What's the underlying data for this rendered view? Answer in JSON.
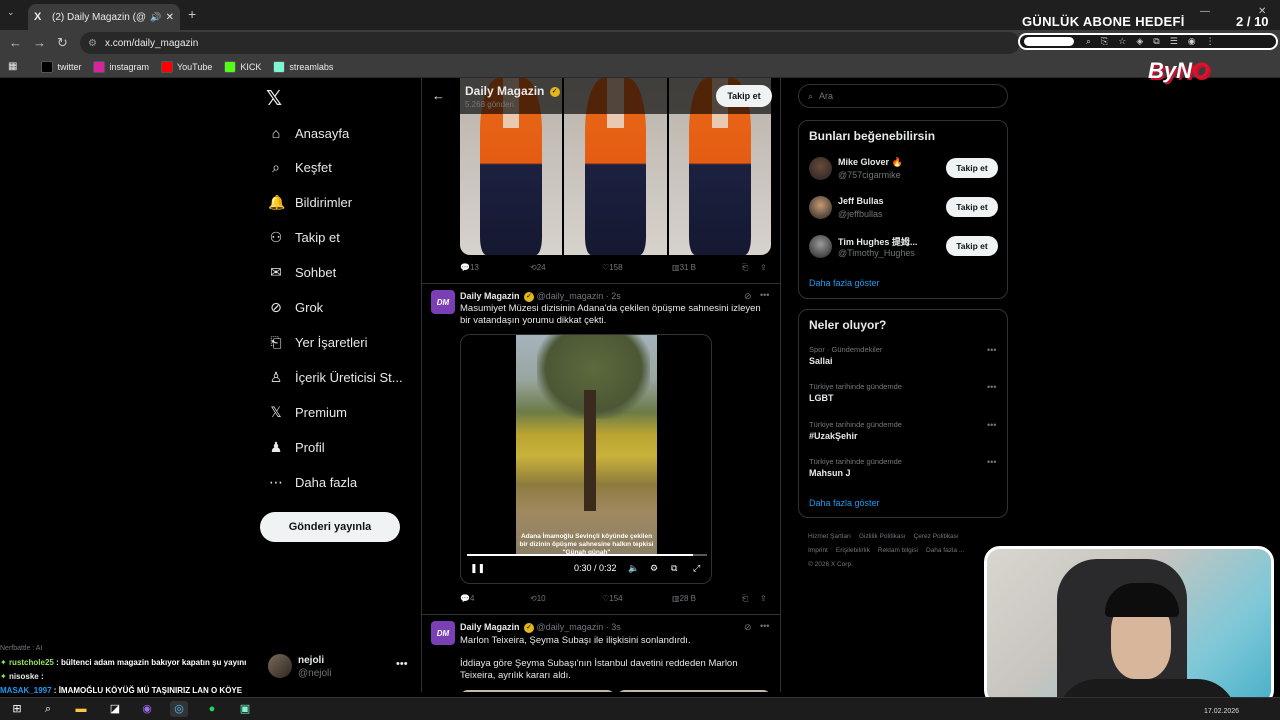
{
  "browser": {
    "tab_title": "(2) Daily Magazin (@daily_m",
    "tab_favicon": "X",
    "url": "x.com/daily_magazin",
    "bookmarks": [
      {
        "label": "twitter",
        "icon": "x-icon",
        "color": "#000000"
      },
      {
        "label": "instagram",
        "icon": "instagram-icon",
        "color": "#d6249f"
      },
      {
        "label": "YouTube",
        "icon": "youtube-icon",
        "color": "#ff0000"
      },
      {
        "label": "KICK",
        "icon": "kick-icon",
        "color": "#53fc18"
      },
      {
        "label": "streamlabs",
        "icon": "streamlabs-icon",
        "color": "#80f5d2"
      }
    ]
  },
  "overlay": {
    "goal_title": "GÜNLÜK ABONE HEDEFİ",
    "goal_count": "2 / 10",
    "goal_progress": 0.2,
    "logo": {
      "a": "ByN",
      "b": "O"
    }
  },
  "left_nav": {
    "items": [
      {
        "label": "Anasayfa",
        "icon": "home-icon"
      },
      {
        "label": "Keşfet",
        "icon": "search-icon"
      },
      {
        "label": "Bildirimler",
        "icon": "bell-icon"
      },
      {
        "label": "Takip et",
        "icon": "add-user-icon"
      },
      {
        "label": "Sohbet",
        "icon": "mail-icon"
      },
      {
        "label": "Grok",
        "icon": "grok-icon"
      },
      {
        "label": "Yer İşaretleri",
        "icon": "bookmark-icon"
      },
      {
        "label": "İçerik Üreticisi St...",
        "icon": "creator-icon"
      },
      {
        "label": "Premium",
        "icon": "x-icon"
      },
      {
        "label": "Profil",
        "icon": "profile-icon"
      },
      {
        "label": "Daha fazla",
        "icon": "more-icon"
      }
    ],
    "post_button": "Gönderi yayınla",
    "account": {
      "name": "nejoli",
      "handle": "@nejoli"
    }
  },
  "chat": {
    "header": "Nerfbattle : AI",
    "messages": [
      {
        "user": "rustchole25",
        "text": " : bültenci adam magazin bakıyor kapatın şu yayını",
        "color": "#9ce65c"
      },
      {
        "user": "nisoske",
        "text": " : ",
        "color": "#e7e9ea"
      },
      {
        "user": "MASAK_1997",
        "text": " : İMAMOĞLU KÖYÜĞ MÜ TAŞINIRIZ LAN O KÖYE",
        "color": "#1d9bf0"
      }
    ]
  },
  "profile_header": {
    "name": "Daily Magazin",
    "post_count": "5.268 gönderi",
    "follow_label": "Takip et"
  },
  "tweets": [
    {
      "stats": {
        "replies": "13",
        "retweets": "24",
        "likes": "158",
        "views": "31 B"
      }
    },
    {
      "name": "Daily Magazin",
      "handle": "@daily_magazin",
      "time": "2s",
      "text": "Masumiyet Müzesi dizisinin Adana'da çekilen öpüşme sahnesini izleyen bir vatandaşın yorumu dikkat çekti.",
      "video": {
        "caption": "Adana İmamoğlu Sevinçli köyünde çekilen bir dizinin öpüşme sahnesine halkın tepkisi \"Günah günah\"",
        "time": "0:30 / 0:32",
        "progress": 0.94
      },
      "stats": {
        "replies": "4",
        "retweets": "10",
        "likes": "154",
        "views": "28 B"
      }
    },
    {
      "name": "Daily Magazin",
      "handle": "@daily_magazin",
      "time": "3s",
      "text": "Marlon Teixeira, Şeyma Subaşı ile ilişkisini sonlandırdı.",
      "text2": "İddiaya göre Şeyma Subaşı'nın İstanbul davetini reddeden Marlon Teixeira, ayrılık kararı aldı."
    }
  ],
  "right": {
    "search_placeholder": "Ara",
    "who_to_follow": {
      "title": "Bunları beğenebilirsin",
      "users": [
        {
          "name": "Mike Glover 🔥",
          "handle": "@757cigarmike",
          "button": "Takip et",
          "color": "#6b4a3a"
        },
        {
          "name": "Jeff Bullas",
          "handle": "@jeffbullas",
          "button": "Takip et",
          "color": "#c89a74"
        },
        {
          "name": "Tim Hughes 提姆...",
          "handle": "@Timothy_Hughes",
          "button": "Takip et",
          "color": "#9a9a9a"
        }
      ],
      "show_more": "Daha fazla göster"
    },
    "trends": {
      "title": "Neler oluyor?",
      "items": [
        {
          "context": "Spor · Gündemdekiler",
          "topic": "Sallai"
        },
        {
          "context": "Türkiye tarihinde gündemde",
          "topic": "LGBT"
        },
        {
          "context": "Türkiye tarihinde gündemde",
          "topic": "#UzakŞehir"
        },
        {
          "context": "Türkiye tarihinde gündemde",
          "topic": "Mahsun J"
        }
      ],
      "show_more": "Daha fazla göster"
    },
    "footer": [
      "Hizmet Şartları",
      "Gizlilik Politikası",
      "Çerez Politikası",
      "Imprint",
      "Erişilebilirlik",
      "Reklam bilgisi",
      "Daha fazla ...",
      "© 2026 X Corp."
    ]
  },
  "taskbar": {
    "date": "17.02.2026"
  }
}
